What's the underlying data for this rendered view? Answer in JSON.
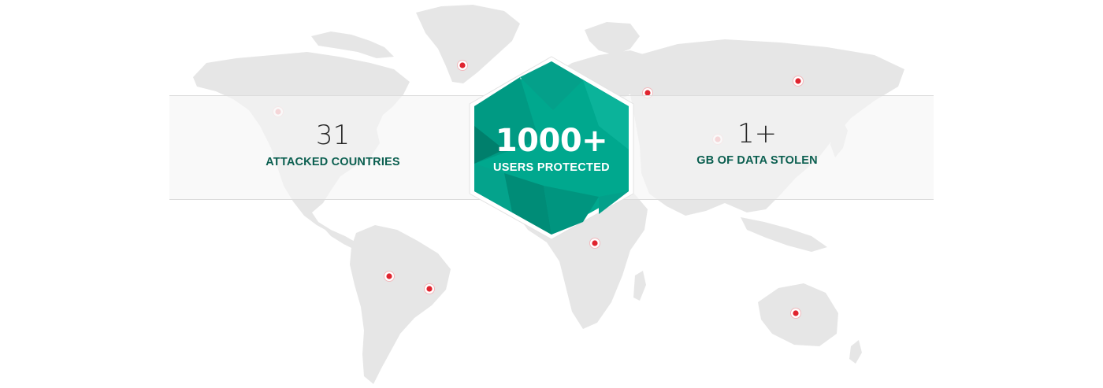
{
  "stats": {
    "attacked_countries": {
      "value": "31",
      "label": "ATTACKED COUNTRIES"
    },
    "users_protected": {
      "value": "1000+",
      "label": "USERS PROTECTED"
    },
    "data_stolen": {
      "value": "1+",
      "label": "GB OF DATA STOLEN"
    }
  },
  "colors": {
    "accent": "#00a88e",
    "accent_dark": "#008a75",
    "label_green": "#0b5f50",
    "marker_red": "#e0242f",
    "map_gray": "#e6e6e6"
  },
  "icons": {
    "map": "world-map",
    "marker": "red-location-dot",
    "badge": "hexagon-badge"
  }
}
